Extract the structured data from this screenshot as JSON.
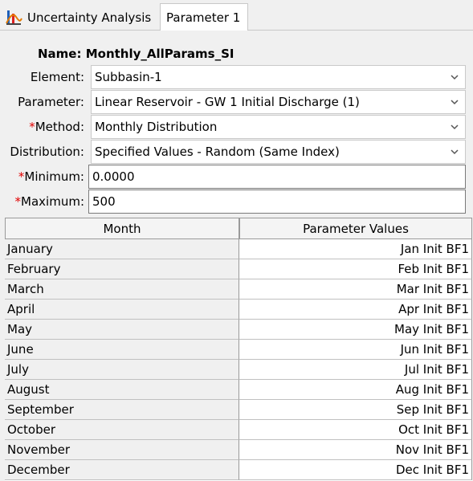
{
  "tabs": [
    {
      "label": "Uncertainty Analysis",
      "icon": "uncertainty-analysis-icon"
    },
    {
      "label": "Parameter 1"
    }
  ],
  "form": {
    "name_label": "Name:",
    "name_value": "Monthly_AllParams_SI",
    "element": {
      "label": "Element:",
      "value": "Subbasin-1"
    },
    "parameter": {
      "label": "Parameter:",
      "value": "Linear Reservoir - GW 1 Initial Discharge (1)"
    },
    "method": {
      "required": "*",
      "label": "Method:",
      "value": "Monthly Distribution"
    },
    "distribution": {
      "label": "Distribution:",
      "value": "Specified Values - Random (Same Index)"
    },
    "minimum": {
      "required": "*",
      "label": "Minimum:",
      "value": "0.0000"
    },
    "maximum": {
      "required": "*",
      "label": "Maximum:",
      "value": "500"
    }
  },
  "table": {
    "headers": [
      "Month",
      "Parameter Values"
    ],
    "rows": [
      {
        "month": "January",
        "value": "Jan Init BF1"
      },
      {
        "month": "February",
        "value": "Feb Init BF1"
      },
      {
        "month": "March",
        "value": "Mar Init BF1"
      },
      {
        "month": "April",
        "value": "Apr Init BF1"
      },
      {
        "month": "May",
        "value": "May Init BF1"
      },
      {
        "month": "June",
        "value": "Jun Init BF1"
      },
      {
        "month": "July",
        "value": "Jul Init BF1"
      },
      {
        "month": "August",
        "value": "Aug Init BF1"
      },
      {
        "month": "September",
        "value": "Sep Init BF1"
      },
      {
        "month": "October",
        "value": "Oct Init BF1"
      },
      {
        "month": "November",
        "value": "Nov Init BF1"
      },
      {
        "month": "December",
        "value": "Dec Init BF1"
      }
    ]
  },
  "colors": {
    "required": "#e00000",
    "panel": "#f0f0f0"
  }
}
